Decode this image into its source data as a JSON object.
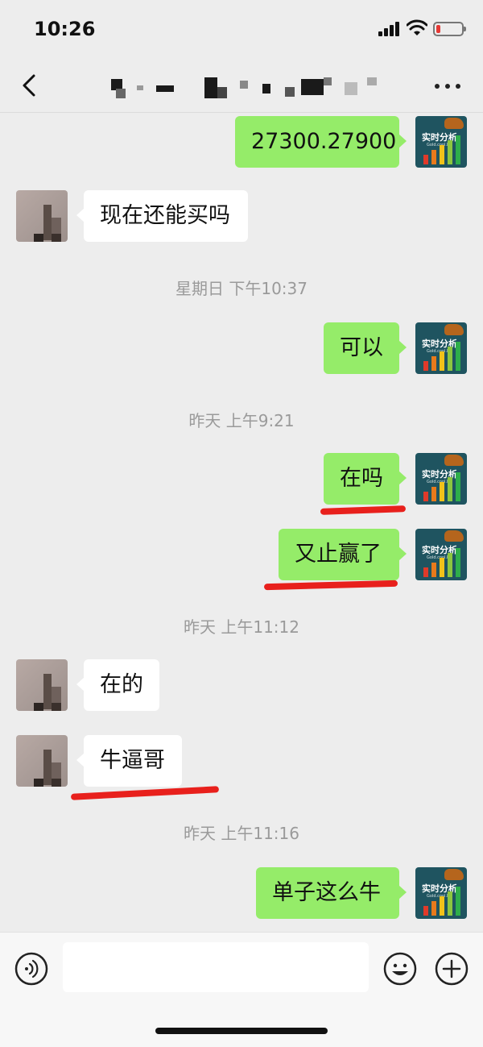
{
  "status_bar": {
    "time": "10:26",
    "battery_color": "#e53935"
  },
  "nav": {
    "title_obscured": true,
    "back_icon": "chevron-left-icon",
    "more_icon": "more-dots-icon"
  },
  "self_avatar": {
    "brand_text": "实时分析",
    "sub_text": "Gold.cool.ltd"
  },
  "messages": [
    {
      "side": "out",
      "text": "27300.27900"
    },
    {
      "side": "in",
      "text": "现在还能买吗"
    },
    {
      "type": "time",
      "text": "星期日 下午10:37"
    },
    {
      "side": "out",
      "text": "可以"
    },
    {
      "type": "time",
      "text": "昨天 上午9:21"
    },
    {
      "side": "out",
      "text": "在吗",
      "underlined": true
    },
    {
      "side": "out",
      "text": "又止赢了",
      "underlined": true
    },
    {
      "type": "time",
      "text": "昨天 上午11:12"
    },
    {
      "side": "in",
      "text": "在的"
    },
    {
      "side": "in",
      "text": "牛逼哥",
      "underlined": true
    },
    {
      "type": "time",
      "text": "昨天 上午11:16"
    },
    {
      "side": "out",
      "text": "单子这么牛"
    }
  ],
  "input_bar": {
    "placeholder": "",
    "voice_icon": "voice-icon",
    "emoji_icon": "emoji-icon",
    "plus_icon": "plus-icon"
  },
  "colors": {
    "outgoing_bubble": "#95ec69",
    "incoming_bubble": "#ffffff",
    "background": "#ededed",
    "annotation_red": "#e8201c"
  }
}
